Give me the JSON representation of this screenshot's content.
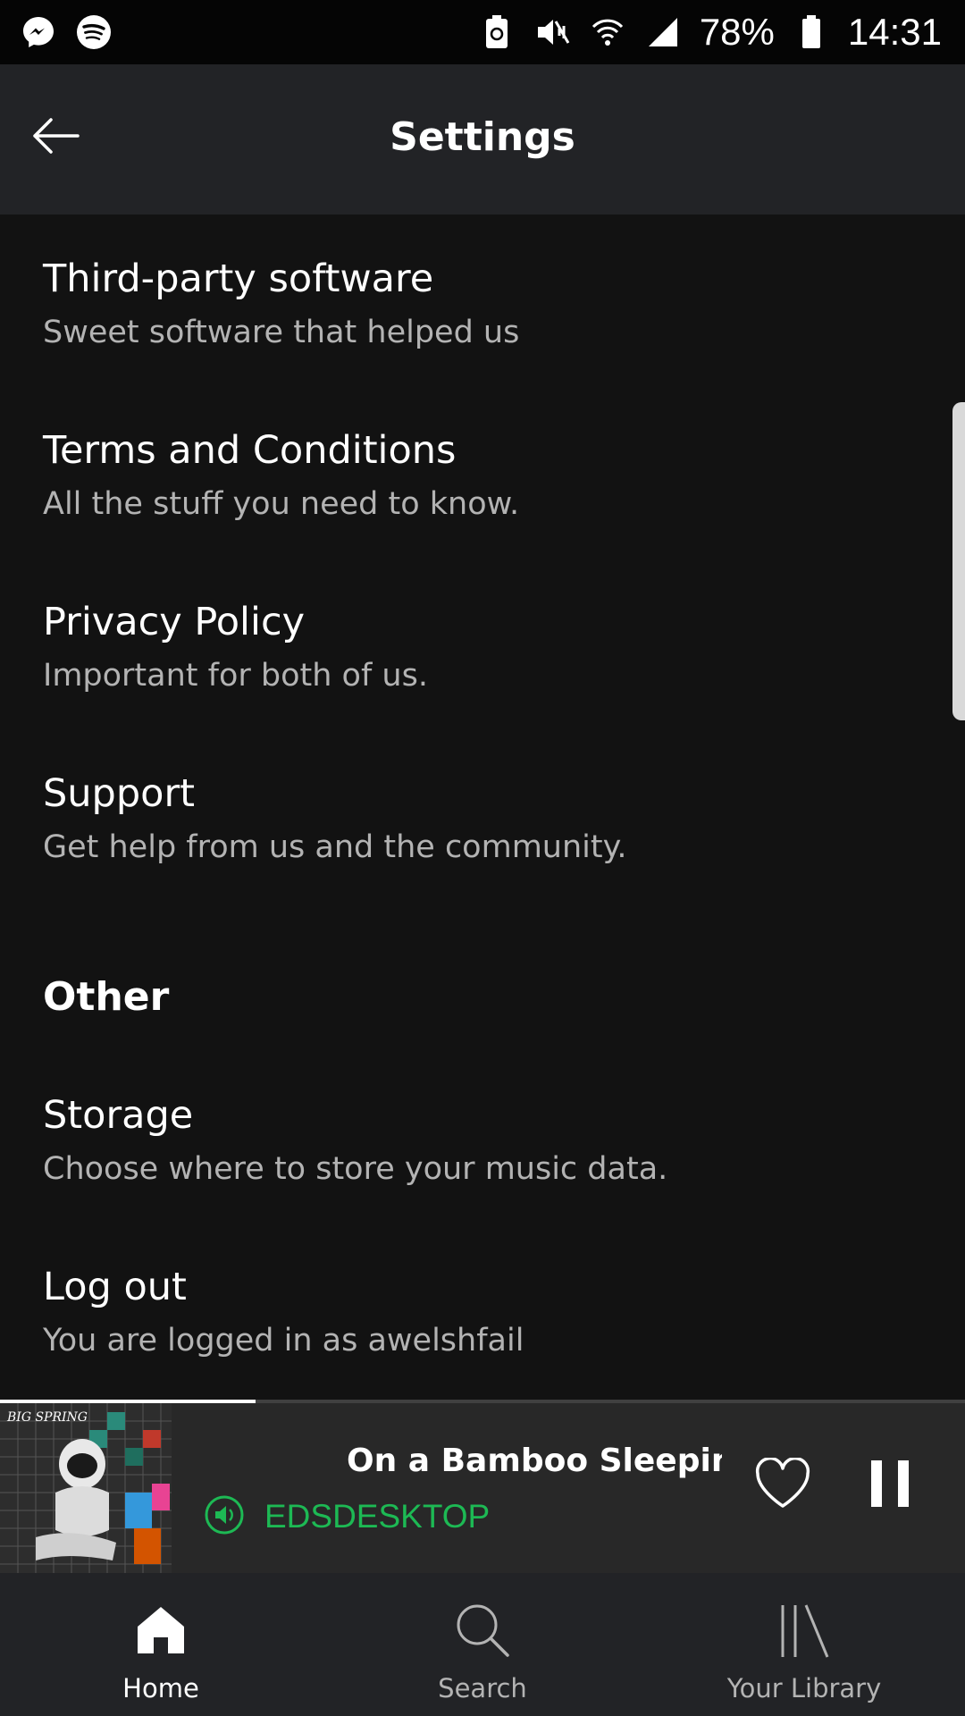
{
  "status_bar": {
    "battery_percent": "78%",
    "time": "14:31",
    "left_icons": [
      "messenger-icon",
      "spotify-icon"
    ],
    "right_icons": [
      "battery-saver-icon",
      "mute-icon",
      "wifi-icon",
      "signal-icon",
      "battery-icon"
    ]
  },
  "header": {
    "title": "Settings",
    "back_icon": "arrow-left-icon"
  },
  "settings_items": [
    {
      "title": "Third-party software",
      "subtitle": "Sweet software that helped us"
    },
    {
      "title": "Terms and Conditions",
      "subtitle": "All the stuff you need to know."
    },
    {
      "title": "Privacy Policy",
      "subtitle": "Important for both of us."
    },
    {
      "title": "Support",
      "subtitle": "Get help from us and the community."
    }
  ],
  "other_section": {
    "heading": "Other",
    "items": [
      {
        "title": "Storage",
        "subtitle": "Choose where to store your music data."
      },
      {
        "title": "Log out",
        "subtitle": "You are logged in as awelshfail"
      }
    ]
  },
  "now_playing": {
    "track_title": "On a Bamboo Sleeping",
    "device_name": "EDSDESKTOP",
    "album_art_text": "BIG SPRING",
    "progress_fraction": 0.265,
    "accent_color": "#1db954"
  },
  "bottom_nav": {
    "items": [
      {
        "label": "Home",
        "icon": "home-icon",
        "active": true
      },
      {
        "label": "Search",
        "icon": "search-icon",
        "active": false
      },
      {
        "label": "Your Library",
        "icon": "library-icon",
        "active": false
      }
    ]
  }
}
